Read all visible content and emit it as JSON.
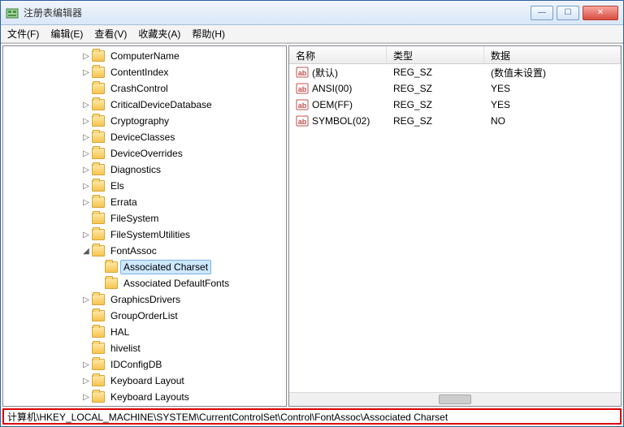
{
  "window": {
    "title": "注册表编辑器"
  },
  "menu": {
    "file": "文件(F)",
    "edit": "编辑(E)",
    "view": "查看(V)",
    "favorites": "收藏夹(A)",
    "help": "帮助(H)"
  },
  "tree": {
    "items": [
      {
        "label": "ComputerName",
        "depth": 6,
        "expander": "▷"
      },
      {
        "label": "ContentIndex",
        "depth": 6,
        "expander": "▷"
      },
      {
        "label": "CrashControl",
        "depth": 6,
        "expander": ""
      },
      {
        "label": "CriticalDeviceDatabase",
        "depth": 6,
        "expander": "▷"
      },
      {
        "label": "Cryptography",
        "depth": 6,
        "expander": "▷"
      },
      {
        "label": "DeviceClasses",
        "depth": 6,
        "expander": "▷"
      },
      {
        "label": "DeviceOverrides",
        "depth": 6,
        "expander": "▷"
      },
      {
        "label": "Diagnostics",
        "depth": 6,
        "expander": "▷"
      },
      {
        "label": "Els",
        "depth": 6,
        "expander": "▷"
      },
      {
        "label": "Errata",
        "depth": 6,
        "expander": "▷"
      },
      {
        "label": "FileSystem",
        "depth": 6,
        "expander": ""
      },
      {
        "label": "FileSystemUtilities",
        "depth": 6,
        "expander": "▷"
      },
      {
        "label": "FontAssoc",
        "depth": 6,
        "expander": "◢",
        "expanded": true
      },
      {
        "label": "Associated Charset",
        "depth": 7,
        "expander": "",
        "selected": true
      },
      {
        "label": "Associated DefaultFonts",
        "depth": 7,
        "expander": ""
      },
      {
        "label": "GraphicsDrivers",
        "depth": 6,
        "expander": "▷"
      },
      {
        "label": "GroupOrderList",
        "depth": 6,
        "expander": ""
      },
      {
        "label": "HAL",
        "depth": 6,
        "expander": ""
      },
      {
        "label": "hivelist",
        "depth": 6,
        "expander": ""
      },
      {
        "label": "IDConfigDB",
        "depth": 6,
        "expander": "▷"
      },
      {
        "label": "Keyboard Layout",
        "depth": 6,
        "expander": "▷"
      },
      {
        "label": "Keyboard Layouts",
        "depth": 6,
        "expander": "▷"
      }
    ]
  },
  "list": {
    "headers": {
      "name": "名称",
      "type": "类型",
      "data": "数据"
    },
    "rows": [
      {
        "name": "(默认)",
        "type": "REG_SZ",
        "data": "(数值未设置)"
      },
      {
        "name": "ANSI(00)",
        "type": "REG_SZ",
        "data": "YES"
      },
      {
        "name": "OEM(FF)",
        "type": "REG_SZ",
        "data": "YES"
      },
      {
        "name": "SYMBOL(02)",
        "type": "REG_SZ",
        "data": "NO"
      }
    ]
  },
  "statusbar": {
    "path": "计算机\\HKEY_LOCAL_MACHINE\\SYSTEM\\CurrentControlSet\\Control\\FontAssoc\\Associated Charset"
  }
}
